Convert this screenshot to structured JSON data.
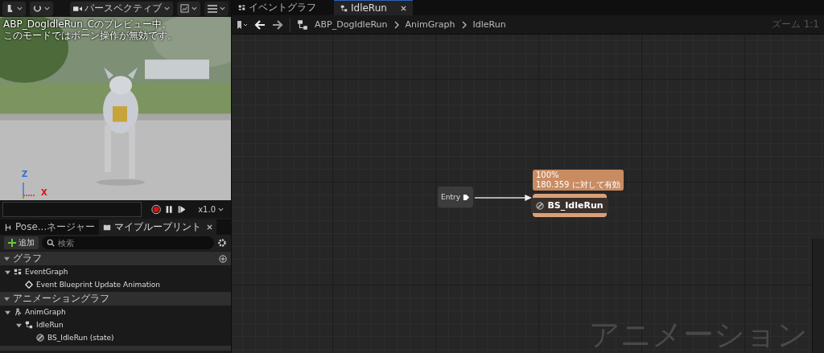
{
  "viewport": {
    "toolbar": {
      "view_mode": "パースペクティブ"
    },
    "overlay_lines": [
      "ABP_DogIdleRun_Cのプレビュー中。",
      "このモードではボーン操作が無効です。"
    ],
    "axes": {
      "z": "Z",
      "x": "X"
    },
    "playback": {
      "recording": true,
      "speed": "x1.0"
    }
  },
  "panel_tabs": [
    {
      "label": "Pose...ネージャー",
      "selected": false,
      "closable": false
    },
    {
      "label": "マイブループリント",
      "selected": true,
      "closable": true
    }
  ],
  "panel_toolbar": {
    "add_label": "追加",
    "search_placeholder": "検索"
  },
  "sections": [
    {
      "title": "グラフ",
      "expanded": true,
      "has_add": true,
      "items": [
        {
          "label": "EventGraph",
          "kind": "graph",
          "expanded": true,
          "children": [
            {
              "label": "Event Blueprint Update Animation",
              "kind": "event"
            }
          ]
        }
      ]
    },
    {
      "title": "アニメーショングラフ",
      "expanded": true,
      "has_add": false,
      "items": [
        {
          "label": "AnimGraph",
          "kind": "anim",
          "expanded": true,
          "children": [
            {
              "label": "IdleRun",
              "kind": "machine",
              "expanded": true,
              "children": [
                {
                  "label": "BS_IdleRun (state)",
                  "kind": "state"
                }
              ]
            }
          ]
        }
      ]
    }
  ],
  "editor_tabs": [
    {
      "label": "イベントグラフ",
      "kind": "graph",
      "selected": false,
      "closable": false
    },
    {
      "label": "IdleRun",
      "kind": "machine",
      "selected": true,
      "closable": true
    }
  ],
  "breadcrumb": [
    "ABP_DogIdleRun",
    "AnimGraph",
    "IdleRun"
  ],
  "zoom": "ズーム 1:1",
  "graph": {
    "entry": "Entry",
    "tooltip_lines": [
      "100%",
      "180.359 に対して有効"
    ],
    "state": "BS_IdleRun",
    "watermark": "アニメーション"
  }
}
